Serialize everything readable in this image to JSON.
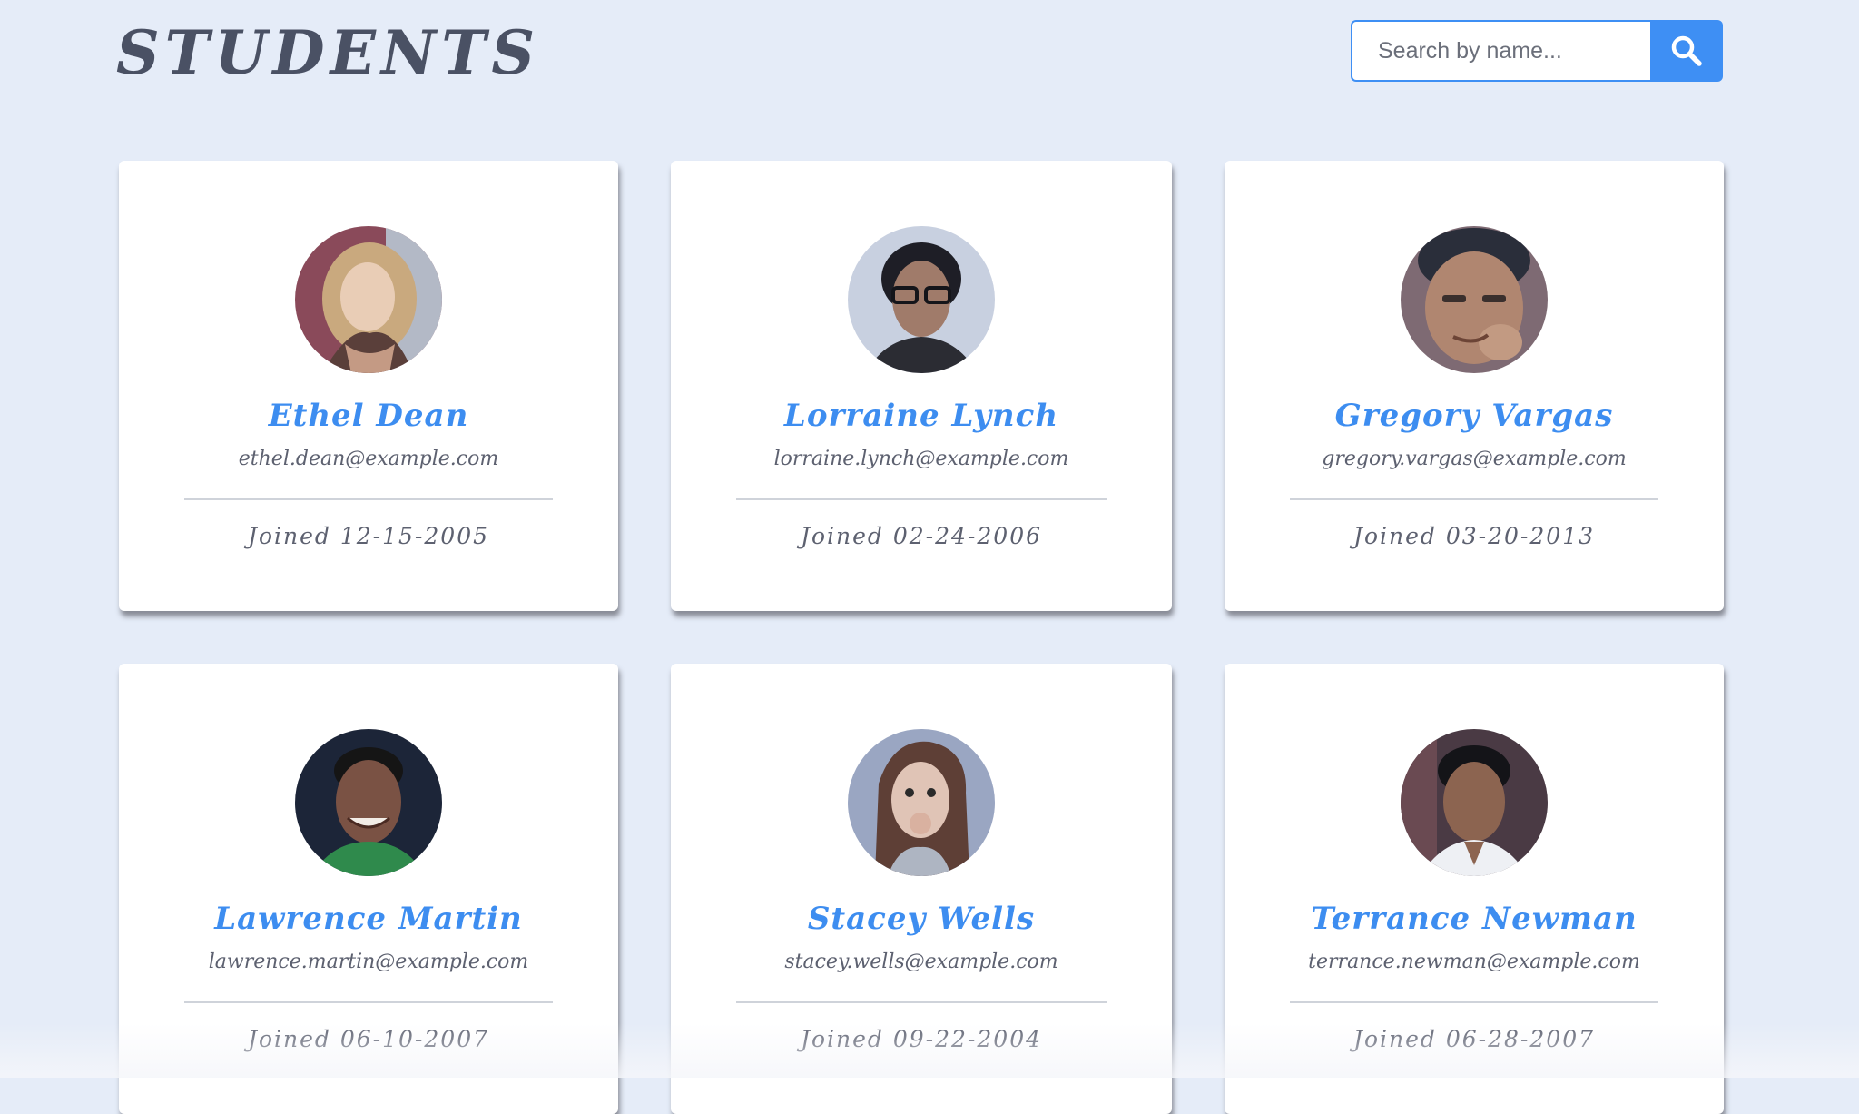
{
  "header": {
    "title": "STUDENTS",
    "search_placeholder": "Search by name...",
    "search_icon": "search-icon"
  },
  "students": [
    {
      "name": "Ethel Dean",
      "email": "ethel.dean@example.com",
      "joined": "Joined 12-15-2005"
    },
    {
      "name": "Lorraine Lynch",
      "email": "lorraine.lynch@example.com",
      "joined": "Joined 02-24-2006"
    },
    {
      "name": "Gregory Vargas",
      "email": "gregory.vargas@example.com",
      "joined": "Joined 03-20-2013"
    },
    {
      "name": "Lawrence Martin",
      "email": "lawrence.martin@example.com",
      "joined": "Joined 06-10-2007"
    },
    {
      "name": "Stacey Wells",
      "email": "stacey.wells@example.com",
      "joined": "Joined 09-22-2004"
    },
    {
      "name": "Terrance Newman",
      "email": "terrance.newman@example.com",
      "joined": "Joined 06-28-2007"
    }
  ],
  "colors": {
    "background": "#e5ecf8",
    "accent": "#3e8ff4",
    "title": "#4a5164",
    "name": "#3d8df0",
    "text": "#5d6170"
  }
}
